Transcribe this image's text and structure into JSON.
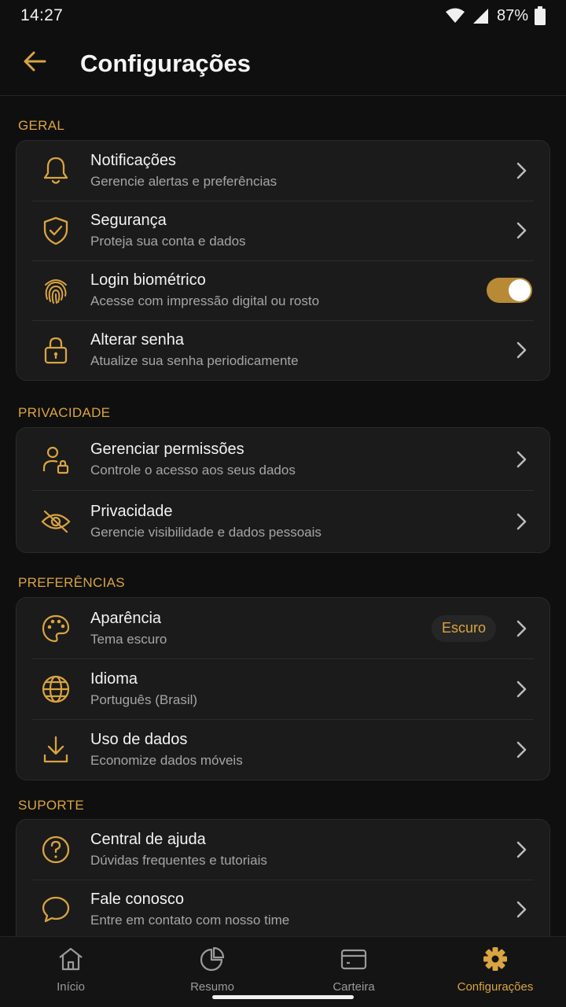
{
  "status": {
    "time": "14:27",
    "battery": "87%"
  },
  "header": {
    "title": "Configurações",
    "back_icon": "arrow-left-icon"
  },
  "colors": {
    "accent": "#d9a441",
    "background": "#0f0f0f",
    "card": "#1b1b1b"
  },
  "sections": {
    "geral": {
      "label": "GERAL",
      "items": [
        {
          "title": "Notificações",
          "subtitle": "Gerencie alertas e preferências",
          "icon": "bell-icon"
        },
        {
          "title": "Segurança",
          "subtitle": "Proteja sua conta e dados",
          "icon": "shield-check-icon"
        },
        {
          "title": "Login biométrico",
          "subtitle": "Acesse com impressão digital ou rosto",
          "icon": "fingerprint-icon",
          "toggle_on": true
        },
        {
          "title": "Alterar senha",
          "subtitle": "Atualize sua senha periodicamente",
          "icon": "lock-icon"
        }
      ]
    },
    "privacidade": {
      "label": "PRIVACIDADE",
      "items": [
        {
          "title": "Gerenciar permissões",
          "subtitle": "Controle o acesso aos seus dados",
          "icon": "user-lock-icon"
        },
        {
          "title": "Privacidade",
          "subtitle": "Gerencie visibilidade e dados pessoais",
          "icon": "eye-off-icon"
        }
      ]
    },
    "preferencias": {
      "label": "PREFERÊNCIAS",
      "items": [
        {
          "title": "Aparência",
          "subtitle": "Tema escuro",
          "icon": "palette-icon",
          "badge": "Escuro"
        },
        {
          "title": "Idioma",
          "subtitle": "Português (Brasil)",
          "icon": "globe-icon"
        },
        {
          "title": "Uso de dados",
          "subtitle": "Economize dados móveis",
          "icon": "download-icon"
        }
      ]
    },
    "suporte": {
      "label": "SUPORTE",
      "items": [
        {
          "title": "Central de ajuda",
          "subtitle": "Dúvidas frequentes e tutoriais",
          "icon": "help-circle-icon"
        },
        {
          "title": "Fale conosco",
          "subtitle": "Entre em contato com nosso time",
          "icon": "chat-bubble-icon"
        }
      ]
    }
  },
  "nav": [
    {
      "label": "Início",
      "icon": "home-icon"
    },
    {
      "label": "Resumo",
      "icon": "pie-chart-icon"
    },
    {
      "label": "Carteira",
      "icon": "wallet-icon"
    },
    {
      "label": "Configurações",
      "icon": "gear-icon",
      "active": true
    }
  ]
}
